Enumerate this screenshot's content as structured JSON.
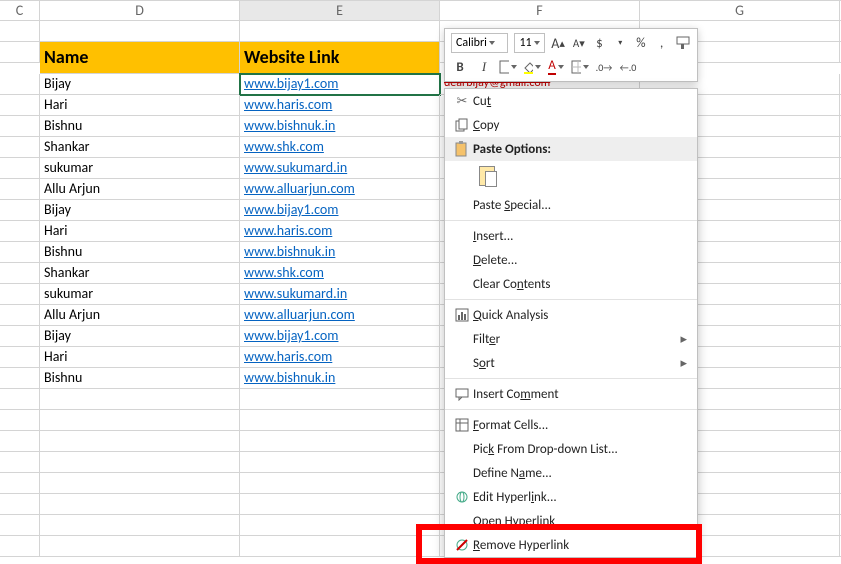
{
  "columns": {
    "C": "C",
    "D": "D",
    "E": "E",
    "F": "F",
    "G": "G"
  },
  "headers": {
    "name": "Name",
    "website": "Website Link"
  },
  "rows": [
    {
      "name": "Bijay",
      "url": "www.bijay1.com"
    },
    {
      "name": "Hari",
      "url": "www.haris.com"
    },
    {
      "name": "Bishnu",
      "url": "www.bishnuk.in"
    },
    {
      "name": "Shankar",
      "url": "www.shk.com"
    },
    {
      "name": "sukumar",
      "url": "www.sukumard.in"
    },
    {
      "name": "Allu Arjun",
      "url": "www.alluarjun.com"
    },
    {
      "name": "Bijay",
      "url": "www.bijay1.com"
    },
    {
      "name": "Hari",
      "url": "www.haris.com"
    },
    {
      "name": "Bishnu",
      "url": "www.bishnuk.in"
    },
    {
      "name": "Shankar",
      "url": "www.shk.com"
    },
    {
      "name": "sukumar",
      "url": "www.sukumard.in"
    },
    {
      "name": "Allu Arjun",
      "url": "www.alluarjun.com"
    },
    {
      "name": "Bijay",
      "url": "www.bijay1.com"
    },
    {
      "name": "Hari",
      "url": "www.haris.com"
    },
    {
      "name": "Bishnu",
      "url": "www.bishnuk.in"
    }
  ],
  "email_preview": "dearbijay@gmail.com",
  "mini": {
    "font": "Calibri",
    "size": "11",
    "increase": "A",
    "decrease": "A",
    "currency": "$",
    "percent": "%",
    "comma": ",",
    "bold": "B",
    "italic": "I"
  },
  "ctx": {
    "cut": "Cut",
    "copy": "Copy",
    "paste_opts": "Paste Options:",
    "paste_special": "Paste Special...",
    "insert": "Insert...",
    "delete": "Delete...",
    "clear": "Clear Contents",
    "quick": "Quick Analysis",
    "filter": "Filter",
    "sort": "Sort",
    "comment": "Insert Comment",
    "format": "Format Cells...",
    "dropdown": "Pick From Drop-down List...",
    "define": "Define Name...",
    "edit_hl": "Edit Hyperlink...",
    "open_hl": "Open Hyperlink",
    "remove_hl": "Remove Hyperlink"
  }
}
